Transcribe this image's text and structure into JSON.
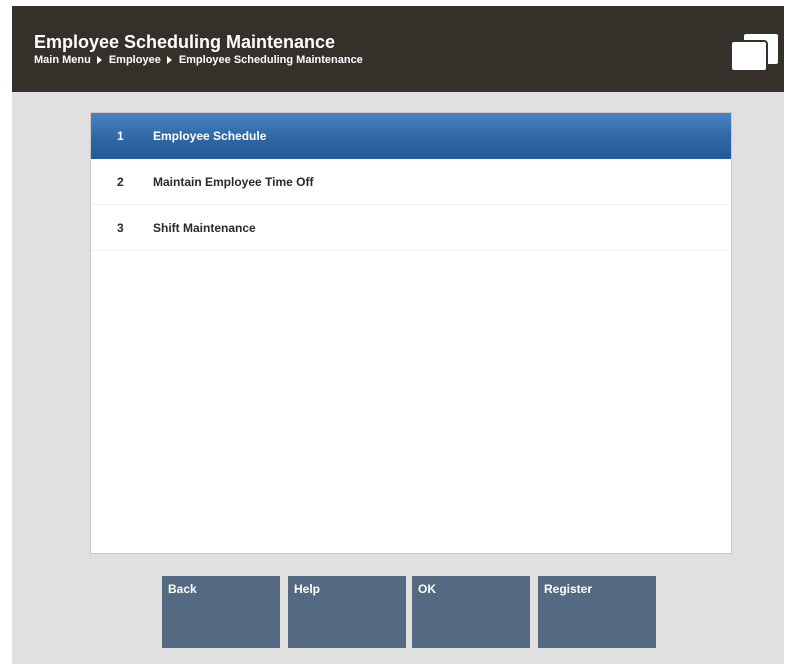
{
  "header": {
    "title": "Employee Scheduling Maintenance",
    "breadcrumb": [
      "Main Menu",
      "Employee",
      "Employee Scheduling Maintenance"
    ],
    "background": "#36302b",
    "icon": "windows-icon"
  },
  "menu": {
    "selected_index": 0,
    "items": [
      {
        "number": "1",
        "label": "Employee Schedule"
      },
      {
        "number": "2",
        "label": "Maintain Employee Time Off"
      },
      {
        "number": "3",
        "label": "Shift Maintenance"
      }
    ],
    "selected_color": "#2f67a6"
  },
  "buttons": [
    {
      "label": "Back"
    },
    {
      "label": "Help"
    },
    {
      "label": "OK"
    },
    {
      "label": "Register"
    }
  ],
  "colors": {
    "button": "#536a82",
    "background": "#e0e0e0"
  }
}
